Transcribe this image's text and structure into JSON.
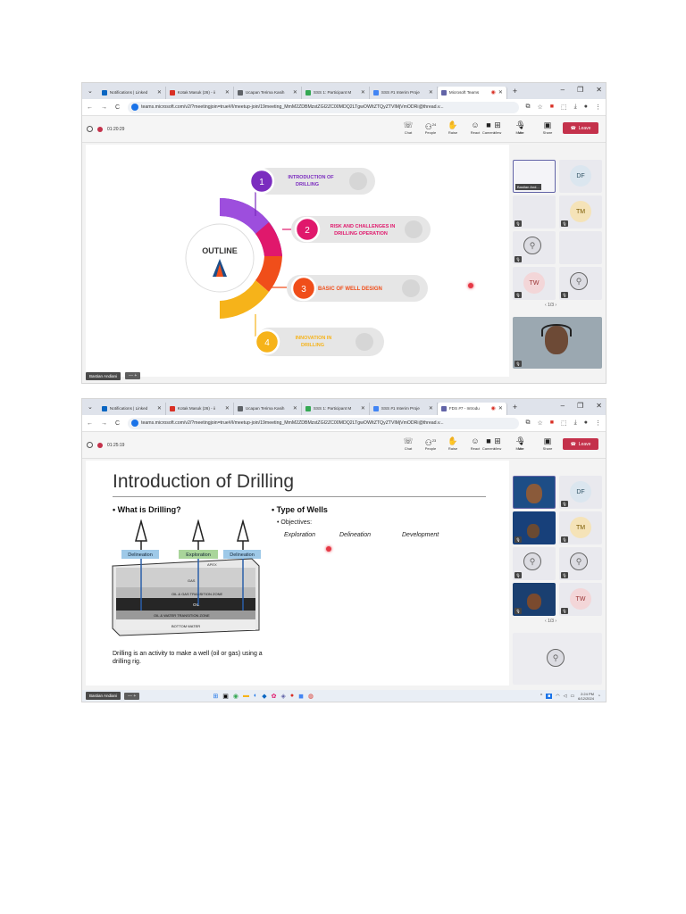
{
  "screens": [
    {
      "tabs": [
        {
          "label": "Notifications | Linked",
          "color": "#0a66c2"
        },
        {
          "label": "Kotak Masuk (26) - ii",
          "color": "#d93025"
        },
        {
          "label": "Ucapan Terima Kasih",
          "color": "#5f6368"
        },
        {
          "label": "SSS 1: Participant M",
          "color": "#34a853"
        },
        {
          "label": "SSS #1 Interim Proje",
          "color": "#4285f4"
        },
        {
          "label": "Microsoft Teams",
          "color": "#6264a7"
        }
      ],
      "url": "teams.microsoft.com/v2/?meetingjoin=true#/l/meetup-join/19meeting_MmM2ZDBMzstZGI2ZC00MDQ2LTgwOWItZTQyZTVlMjVmODRi@thread.v...",
      "timer": "01:20:29",
      "buttons": {
        "chat": "Chat",
        "people": "People",
        "people_count": "24",
        "raise": "Raise",
        "react": "React",
        "view": "View",
        "more": "More",
        "camera": "Camera",
        "mic": "Mic",
        "share": "Share",
        "leave": "Leave"
      },
      "footer_name": "Bastian Andiani",
      "slide": {
        "center": "OUTLINE",
        "items": [
          {
            "num": "1",
            "text": "INTRODUCTION OF DRILLING",
            "color": "#7b2cbf"
          },
          {
            "num": "2",
            "text": "RISK AND CHALLENGES IN DRILLING OPERATION",
            "color": "#e0186c"
          },
          {
            "num": "3",
            "text": "BASIC OF WELL DESIGN",
            "color": "#f04e1a"
          },
          {
            "num": "4",
            "text": "INNOVATION IN DRILLING",
            "color": "#f6b31a"
          }
        ]
      },
      "gallery": {
        "self_label": "Bastian And...",
        "tiles": [
          "DF",
          "TM",
          "",
          "TW",
          ""
        ],
        "pager": "1/3"
      }
    },
    {
      "tabs": [
        {
          "label": "Notifications | Linked",
          "color": "#0a66c2"
        },
        {
          "label": "Kotak Masuk (26) - ii",
          "color": "#d93025"
        },
        {
          "label": "Ucapan Terima Kasih",
          "color": "#5f6368"
        },
        {
          "label": "SSS 1: Participant M",
          "color": "#34a853"
        },
        {
          "label": "SSS #1 Interim Proje",
          "color": "#4285f4"
        },
        {
          "label": "FDS #7 - Introdu",
          "color": "#6264a7"
        }
      ],
      "url": "teams.microsoft.com/v2/?meetingjoin=true#/l/meetup-join/19meeting_MmM2ZDBMzstZGI2ZC00MDQ2LTgwOWItZTQyZTVlMjVmODRi@thread.v...",
      "timer": "01:25:19",
      "buttons": {
        "chat": "Chat",
        "people": "People",
        "people_count": "23",
        "raise": "Raise",
        "react": "React",
        "view": "View",
        "more": "More",
        "camera": "Camera",
        "mic": "Mic",
        "share": "Share",
        "leave": "Leave"
      },
      "footer_name": "Bastian Andiani",
      "slide": {
        "title": "Introduction of Drilling",
        "left_heading": "What is Drilling?",
        "right_heading": "Type of Wells",
        "objectives": "Objectives:",
        "types": [
          "Exploration",
          "Delineation",
          "Development"
        ],
        "diagram_labels": [
          "Delineation",
          "Exploration",
          "Delineation"
        ],
        "layers": [
          "APEX",
          "GAS",
          "OIL & GAS TRANSITION ZONE",
          "OIL",
          "OIL & WATER TRANSITION ZONE",
          "BOTTOM WATER"
        ],
        "caption": "Drilling is an activity to make a well (oil or gas) using a drilling rig."
      },
      "gallery": {
        "tiles": [
          "",
          "DF",
          "",
          "TM",
          "",
          "",
          "",
          "TW"
        ],
        "pager": "1/3"
      },
      "clock": {
        "time": "2:24 PM",
        "date": "6/12/2024"
      }
    }
  ],
  "colors": {
    "teams_purple": "#6264a7",
    "leave_red": "#c4314b",
    "chrome_blue": "#1a73e8"
  }
}
